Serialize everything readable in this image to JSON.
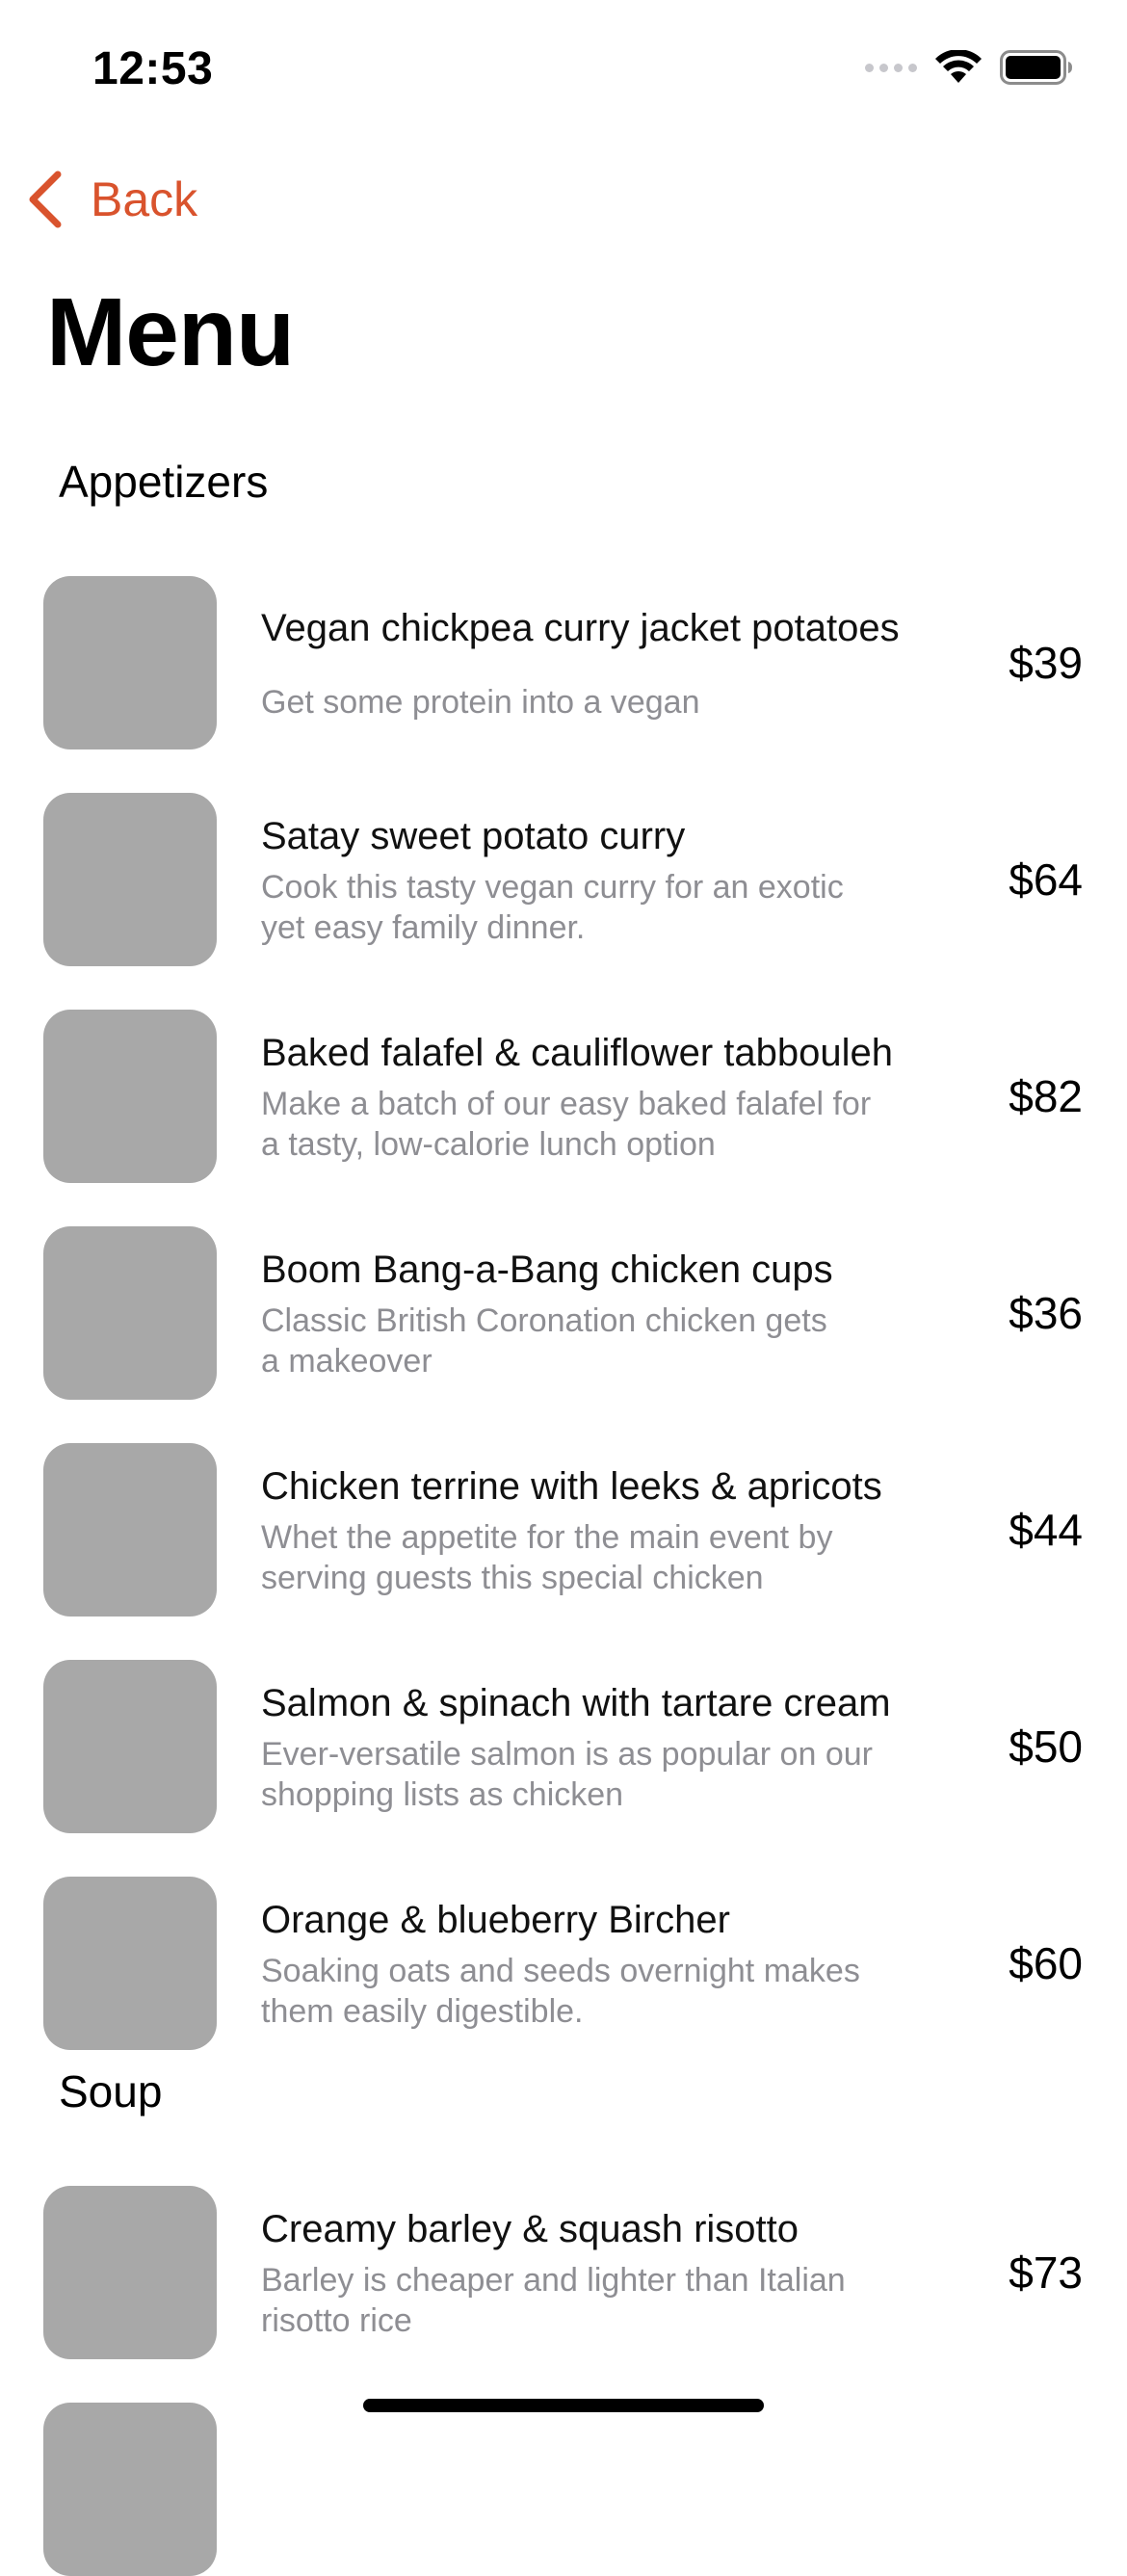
{
  "status_bar": {
    "time": "12:53"
  },
  "nav": {
    "back_label": "Back",
    "accent_color": "#d9532d"
  },
  "page_title": "Menu",
  "sections": [
    {
      "title": "Appetizers",
      "items": [
        {
          "name": "Vegan chickpea curry jacket potatoes",
          "description": "Get some protein into a vegan",
          "price": "$39"
        },
        {
          "name": "Satay sweet potato curry",
          "description": "Cook this tasty vegan curry for an exotic\nyet easy family dinner.",
          "price": "$64"
        },
        {
          "name": "Baked falafel & cauliflower tabbouleh",
          "description": "Make a batch of our easy baked falafel for\na tasty, low-calorie lunch option",
          "price": "$82"
        },
        {
          "name": "Boom Bang-a-Bang chicken cups",
          "description": "Classic British Coronation chicken gets\na makeover",
          "price": "$36"
        },
        {
          "name": "Chicken terrine with leeks & apricots",
          "description": "Whet the appetite for the main event by\nserving guests this special chicken",
          "price": "$44"
        },
        {
          "name": "Salmon & spinach with tartare cream",
          "description": "Ever-versatile salmon is as popular on our\nshopping lists as chicken",
          "price": "$50"
        },
        {
          "name": "Orange & blueberry Bircher",
          "description": "Soaking oats and seeds overnight makes\nthem easily digestible.",
          "price": "$60"
        }
      ]
    },
    {
      "title": "Soup",
      "items": [
        {
          "name": "Creamy barley & squash risotto",
          "description": "Barley is cheaper and lighter than Italian\nrisotto rice",
          "price": "$73"
        }
      ]
    }
  ]
}
